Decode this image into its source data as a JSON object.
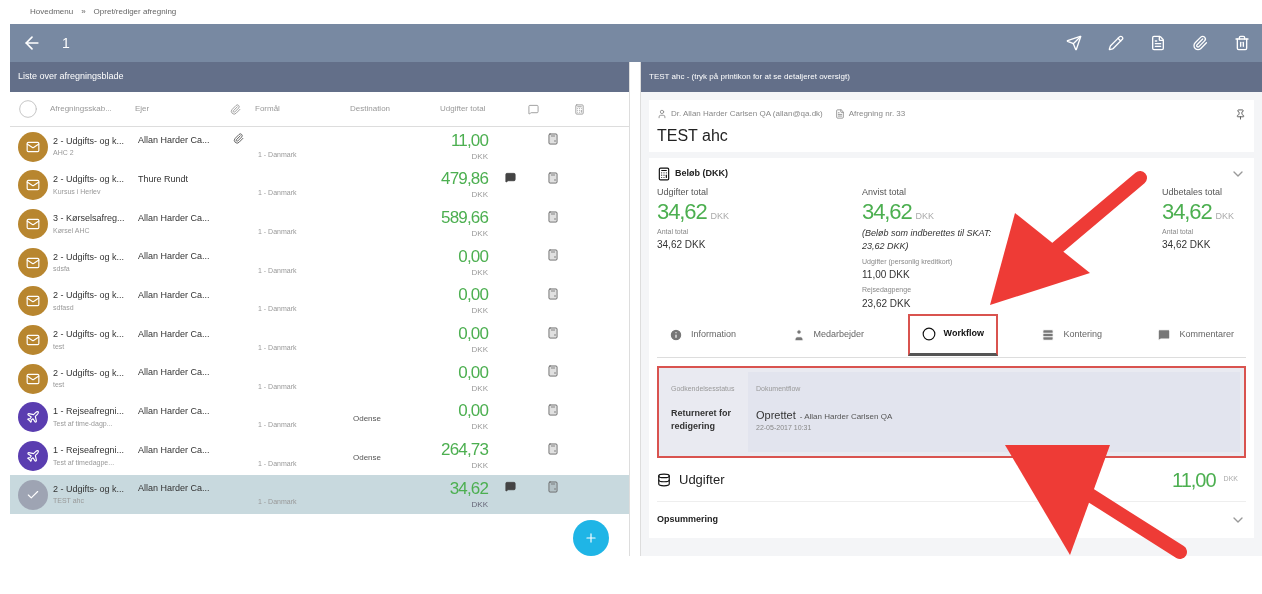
{
  "breadcrumb": [
    "Hovedmenu",
    "»",
    "Opret/rediger afregning"
  ],
  "header": {
    "title": "1"
  },
  "list": {
    "title": "Liste over afregningsblade",
    "columns": [
      "Afregningsskab...",
      "Ejer",
      "Formål",
      "Destination",
      "Udgifter total"
    ],
    "rows": [
      {
        "kind": "envelope",
        "title": "2 - Udgifts- og k...",
        "owner": "Allan Harder Ca...",
        "subtitle": "AHC 2",
        "country": "1 - Danmark",
        "destination": "",
        "amount": "11,00",
        "currency": "DKK",
        "attachment": true,
        "comment": false,
        "selected": false
      },
      {
        "kind": "envelope",
        "title": "2 - Udgifts- og k...",
        "owner": "Thure Rundt",
        "subtitle": "Kursus i Herlev",
        "country": "1 - Danmark",
        "destination": "",
        "amount": "479,86",
        "currency": "DKK",
        "attachment": false,
        "comment": true,
        "selected": false
      },
      {
        "kind": "envelope",
        "title": "3 - Kørselsafreg...",
        "owner": "Allan Harder Ca...",
        "subtitle": "Kørsel AHC",
        "country": "1 - Danmark",
        "destination": "",
        "amount": "589,66",
        "currency": "DKK",
        "attachment": false,
        "comment": false,
        "selected": false
      },
      {
        "kind": "envelope",
        "title": "2 - Udgifts- og k...",
        "owner": "Allan Harder Ca...",
        "subtitle": "sdsfa",
        "country": "1 - Danmark",
        "destination": "",
        "amount": "0,00",
        "currency": "DKK",
        "attachment": false,
        "comment": false,
        "selected": false
      },
      {
        "kind": "envelope",
        "title": "2 - Udgifts- og k...",
        "owner": "Allan Harder Ca...",
        "subtitle": "sdfasd",
        "country": "1 - Danmark",
        "destination": "",
        "amount": "0,00",
        "currency": "DKK",
        "attachment": false,
        "comment": false,
        "selected": false
      },
      {
        "kind": "envelope",
        "title": "2 - Udgifts- og k...",
        "owner": "Allan Harder Ca...",
        "subtitle": "test",
        "country": "1 - Danmark",
        "destination": "",
        "amount": "0,00",
        "currency": "DKK",
        "attachment": false,
        "comment": false,
        "selected": false
      },
      {
        "kind": "envelope",
        "title": "2 - Udgifts- og k...",
        "owner": "Allan Harder Ca...",
        "subtitle": "test",
        "country": "1 - Danmark",
        "destination": "",
        "amount": "0,00",
        "currency": "DKK",
        "attachment": false,
        "comment": false,
        "selected": false
      },
      {
        "kind": "plane",
        "title": "1 - Rejseafregni...",
        "owner": "Allan Harder Ca...",
        "subtitle": "Test af time-dagp...",
        "country": "1 - Danmark",
        "destination": "Odense",
        "amount": "0,00",
        "currency": "DKK",
        "attachment": false,
        "comment": false,
        "selected": false
      },
      {
        "kind": "plane",
        "title": "1 - Rejseafregni...",
        "owner": "Allan Harder Ca...",
        "subtitle": "Test af timedagpe...",
        "country": "1 - Danmark",
        "destination": "Odense",
        "amount": "264,73",
        "currency": "DKK",
        "attachment": false,
        "comment": false,
        "selected": false
      },
      {
        "kind": "envelope",
        "title": "2 - Udgifts- og k...",
        "owner": "Allan Harder Ca...",
        "subtitle": "TEST ahc",
        "country": "1 - Danmark",
        "destination": "",
        "amount": "34,62",
        "currency": "DKK",
        "attachment": false,
        "comment": true,
        "selected": true
      }
    ]
  },
  "detail": {
    "title": "TEST ahc - (tryk på printikon for at se detaljeret oversigt)",
    "owner": "Dr. Allan Harder Carlsen QA (allan@qa.dk)",
    "number": "Afregning nr. 33",
    "name": "TEST ahc",
    "amount_section": {
      "title": "Beløb (DKK)",
      "columns": [
        [
          {
            "kind": "big",
            "label": "Udgifter total",
            "value": "34,62",
            "currency": "DKK"
          },
          {
            "kind": "small",
            "label": "Antal total",
            "value": "34,62 DKK"
          }
        ],
        [
          {
            "kind": "big",
            "label": "Anvist total",
            "value": "34,62",
            "currency": "DKK"
          },
          {
            "kind": "note",
            "value": "(Beløb som indberettes til SKAT: 23,62 DKK)"
          },
          {
            "kind": "small",
            "label": "Udgifter (personlig kreditkort)",
            "value": "11,00 DKK"
          },
          {
            "kind": "small",
            "label": "Rejsedagpenge",
            "value": "23,62 DKK"
          }
        ],
        [
          {
            "kind": "big",
            "label": "Udbetales total",
            "value": "34,62",
            "currency": "DKK"
          },
          {
            "kind": "small",
            "label": "Antal total",
            "value": "34,62 DKK"
          }
        ]
      ]
    },
    "tabs": [
      {
        "kind": "info",
        "label": "Information",
        "selected": false
      },
      {
        "kind": "person",
        "label": "Medarbejder",
        "selected": false
      },
      {
        "kind": "workflow",
        "label": "Workflow",
        "selected": true
      },
      {
        "kind": "table",
        "label": "Kontering",
        "selected": false
      },
      {
        "kind": "comment",
        "label": "Kommentarer",
        "selected": false
      }
    ],
    "workflow": {
      "status_header": "Godkendelsesstatus",
      "flow_header": "Dokumentflow",
      "status": "Returneret for redigering",
      "entries": [
        {
          "action": "Oprettet",
          "by": "- Allan Harder Carlsen QA",
          "date": "22-05-2017 10:31"
        }
      ]
    },
    "expenses": {
      "title": "Udgifter",
      "amount": "11,00",
      "currency": "DKK"
    },
    "summary": {
      "title": "Opsummering"
    }
  }
}
